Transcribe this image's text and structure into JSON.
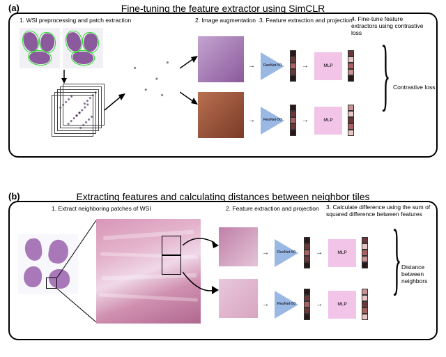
{
  "panel_a": {
    "tag": "(a)",
    "title": "Fine-tuning the feature extractor using SimCLR",
    "steps": {
      "s1": "1. WSI preprocessing and patch extraction",
      "s2": "2. Image augmentation",
      "s3": "3. Feature extraction and projection",
      "s4": "4. Fine-tune feature extractors using contrastive loss"
    },
    "resnet_label": "ResNet-50",
    "mlp_label": "MLP",
    "output_label": "Contrastive loss"
  },
  "panel_b": {
    "tag": "(b)",
    "title": "Extracting features and calculating distances between neighbor tiles",
    "steps": {
      "s1": "1. Extract neighboring patches of WSI",
      "s2": "2. Feature extraction and projection",
      "s3": "3. Calculate difference using the sum of squared difference between features"
    },
    "resnet_label": "ResNet-50",
    "mlp_label": "MLP",
    "output_label": "Distance between neighbors"
  }
}
